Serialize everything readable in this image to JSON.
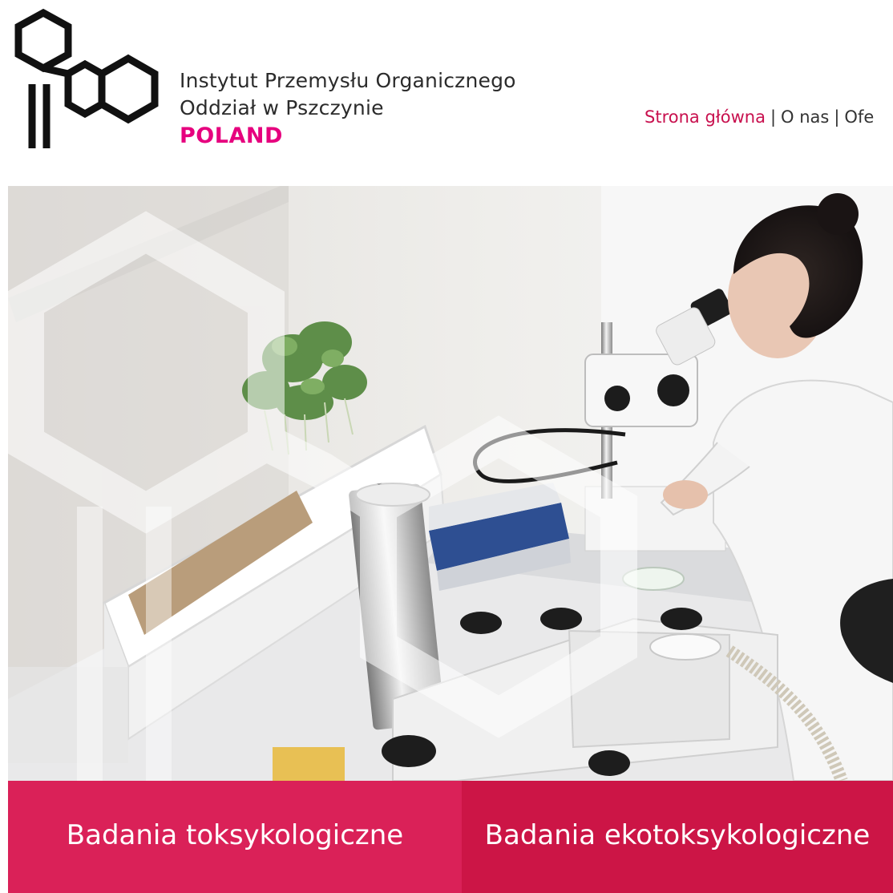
{
  "brand": {
    "line1": "Instytut Przemysłu Organicznego",
    "line2": "Oddział w Pszczynie",
    "line3": "POLAND",
    "accent_color": "#e6007e"
  },
  "nav": {
    "items": [
      {
        "label": "Strona główna",
        "active": true
      },
      {
        "label": "O nas",
        "active": false
      },
      {
        "label": "Ofe",
        "active": false
      }
    ],
    "separator": "|",
    "active_color": "#c8104e"
  },
  "hero": {
    "image": "laboratory-photo"
  },
  "tiles": [
    {
      "label": "Badania toksykologiczne",
      "color": "#da2158"
    },
    {
      "label": "Badania ekotoksykologiczne",
      "color": "#cc1546"
    }
  ]
}
